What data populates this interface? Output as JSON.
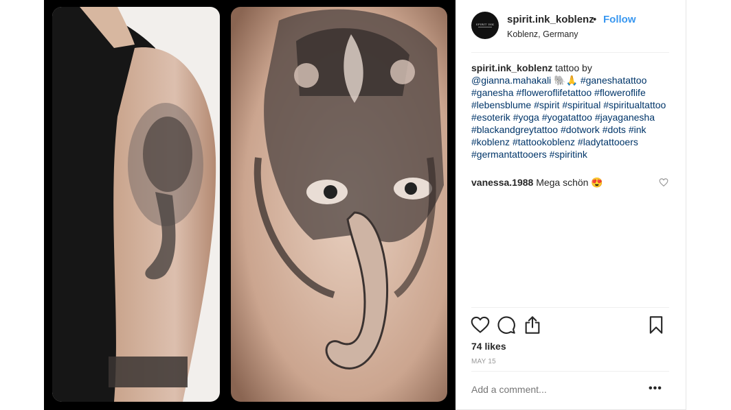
{
  "post": {
    "username": "spirit.ink_koblenz",
    "separator": "•",
    "follow_label": "Follow",
    "location": "Koblenz, Germany",
    "avatar_text": "SPIRIT INK",
    "caption": {
      "username": "spirit.ink_koblenz",
      "text": " tattoo by ",
      "mention": "@gianna.mahakali",
      "emoji": " 🐘🙏 ",
      "hashtags": [
        "#ganeshatattoo",
        "#ganesha",
        "#floweroflifetattoo",
        "#floweroflife",
        "#lebensblume",
        "#spirit",
        "#spiritual",
        "#spiritualtattoo",
        "#esoterik",
        "#yoga",
        "#yogatattoo",
        "#jayaganesha",
        "#blackandgreytattoo",
        "#dotwork",
        "#dots",
        "#ink",
        "#koblenz",
        "#tattookoblenz",
        "#ladytattooers",
        "#germantattooers",
        "#spiritink"
      ]
    },
    "comment": {
      "username": "vanessa.1988",
      "text": " Mega schön 😍"
    },
    "likes": "74 likes",
    "date": "MAY 15",
    "add_comment_placeholder": "Add a comment...",
    "more_label": "•••"
  },
  "icons": {
    "like": "heart-icon",
    "comment": "comment-icon",
    "share": "share-icon",
    "save": "bookmark-icon"
  },
  "colors": {
    "link": "#003569",
    "follow": "#3897f0",
    "muted": "#999999"
  }
}
